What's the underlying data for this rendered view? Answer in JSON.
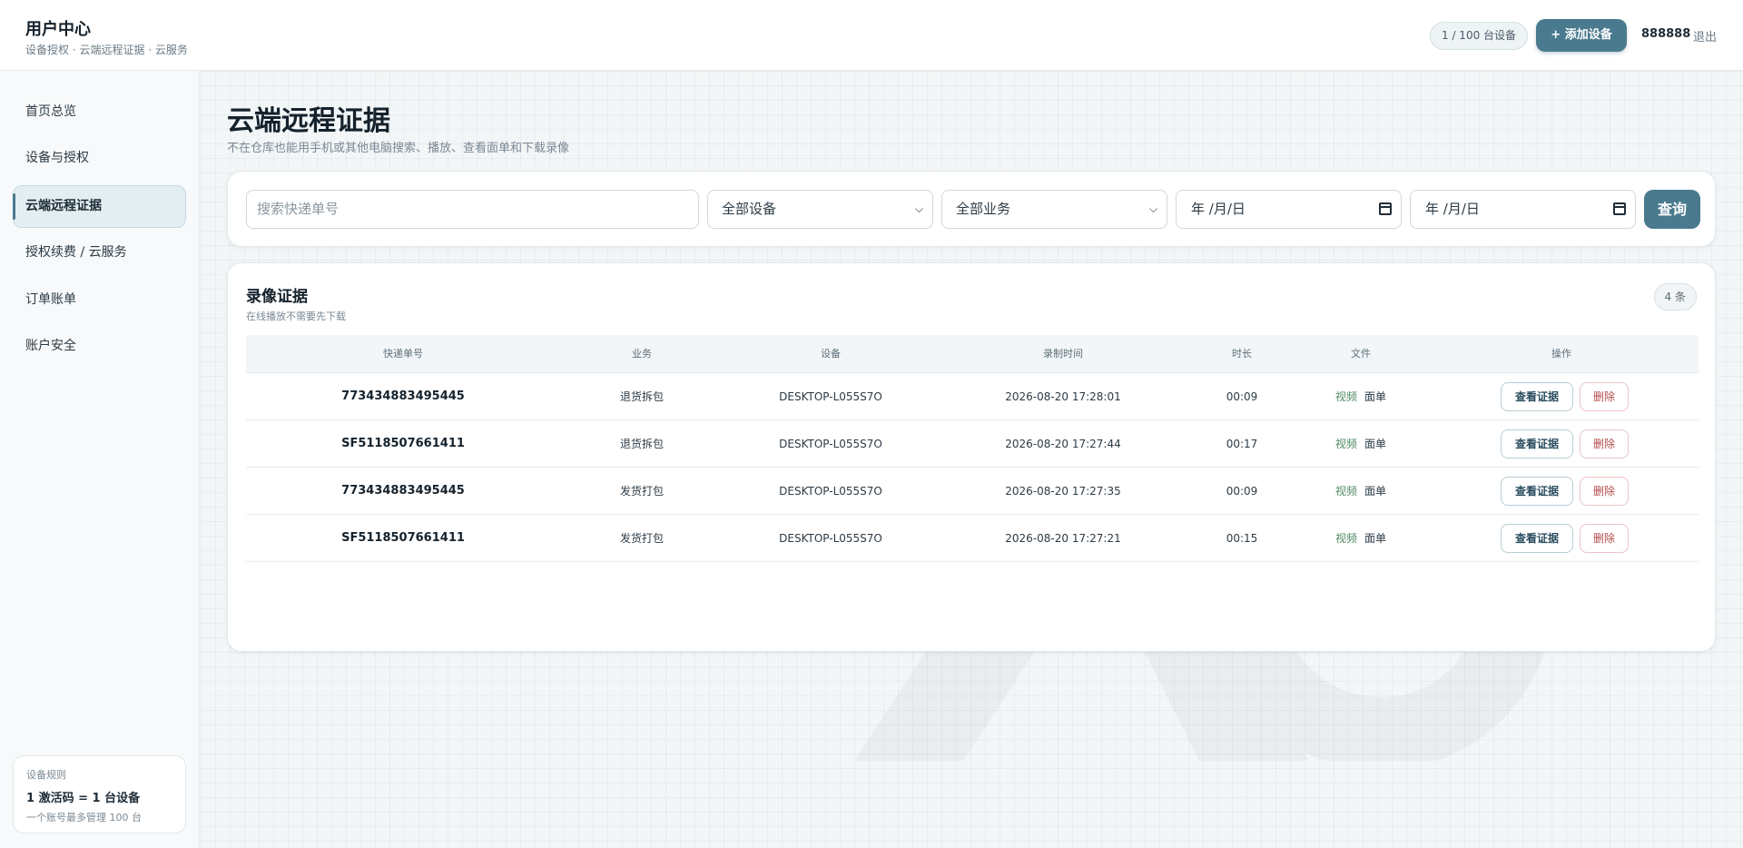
{
  "header": {
    "title": "用户中心",
    "subtitle": "设备授权 · 云端远程证据 · 云服务",
    "device_count": "1 / 100 台设备",
    "add_button": "+ 添加设备",
    "username": "888888",
    "logout": "退出"
  },
  "sidebar": {
    "items": [
      {
        "label": "首页总览"
      },
      {
        "label": "设备与授权"
      },
      {
        "label": "云端远程证据"
      },
      {
        "label": "授权续费 / 云服务"
      },
      {
        "label": "订单账单"
      },
      {
        "label": "账户安全"
      }
    ],
    "active_index": 2,
    "rule_card": {
      "title": "设备规则",
      "main": "1 激活码 = 1 台设备",
      "note": "一个账号最多管理 100 台"
    }
  },
  "page": {
    "title": "云端远程证据",
    "subtitle": "不在仓库也能用手机或其他电脑搜索、播放、查看面单和下载录像"
  },
  "filters": {
    "search_placeholder": "搜索快递单号",
    "device_select": "全部设备",
    "business_select": "全部业务",
    "date_start": "年 /月/日",
    "date_end": "年 /月/日",
    "query_button": "查询"
  },
  "records": {
    "title": "录像证据",
    "subtitle": "在线播放不需要先下载",
    "count": "4 条",
    "columns": [
      "快递单号",
      "业务",
      "设备",
      "录制时间",
      "时长",
      "文件",
      "操作"
    ],
    "rows": [
      {
        "code": "773434883495445",
        "business": "退货拆包",
        "device": "DESKTOP-L055S7O",
        "time": "2026-08-20 17:28:01",
        "duration": "00:09",
        "file_video": "视频",
        "file_sheet": "面单"
      },
      {
        "code": "SF5118507661411",
        "business": "退货拆包",
        "device": "DESKTOP-L055S7O",
        "time": "2026-08-20 17:27:44",
        "duration": "00:17",
        "file_video": "视频",
        "file_sheet": "面单"
      },
      {
        "code": "773434883495445",
        "business": "发货打包",
        "device": "DESKTOP-L055S7O",
        "time": "2026-08-20 17:27:35",
        "duration": "00:09",
        "file_video": "视频",
        "file_sheet": "面单"
      },
      {
        "code": "SF5118507661411",
        "business": "发货打包",
        "device": "DESKTOP-L055S7O",
        "time": "2026-08-20 17:27:21",
        "duration": "00:15",
        "file_video": "视频",
        "file_sheet": "面单"
      }
    ],
    "view_button": "查看证据",
    "delete_button": "删除"
  },
  "colors": {
    "accent": "#4a7a8e",
    "danger": "#b24a4a",
    "video_link": "#4f8a64"
  }
}
